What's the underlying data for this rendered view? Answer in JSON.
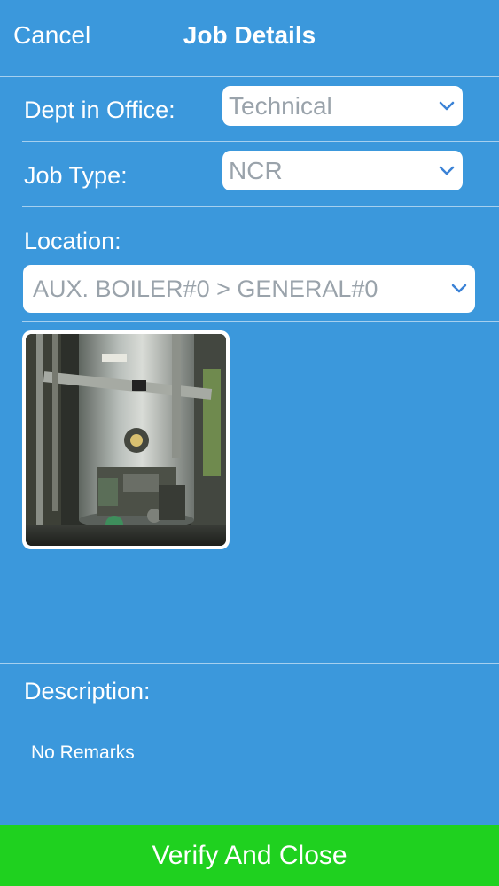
{
  "header": {
    "cancel_label": "Cancel",
    "title": "Job Details"
  },
  "form": {
    "dept": {
      "label": "Dept in Office:",
      "value": "Technical",
      "icon": "chevron-down-icon"
    },
    "job_type": {
      "label": "Job Type:",
      "value": "NCR",
      "icon": "chevron-down-icon"
    },
    "location": {
      "label": "Location:",
      "value": "AUX. BOILER#0 > GENERAL#0",
      "icon": "chevron-down-icon"
    },
    "attachment": {
      "image_subject": "auxiliary boiler photo"
    },
    "description": {
      "label": "Description:",
      "text": "No Remarks"
    }
  },
  "footer": {
    "verify_label": "Verify And Close"
  },
  "colors": {
    "background": "#3b98dc",
    "field_background": "#ffffff",
    "field_text": "#9aa3ab",
    "chevron": "#3b82d6",
    "verify_button": "#1fd11f"
  }
}
